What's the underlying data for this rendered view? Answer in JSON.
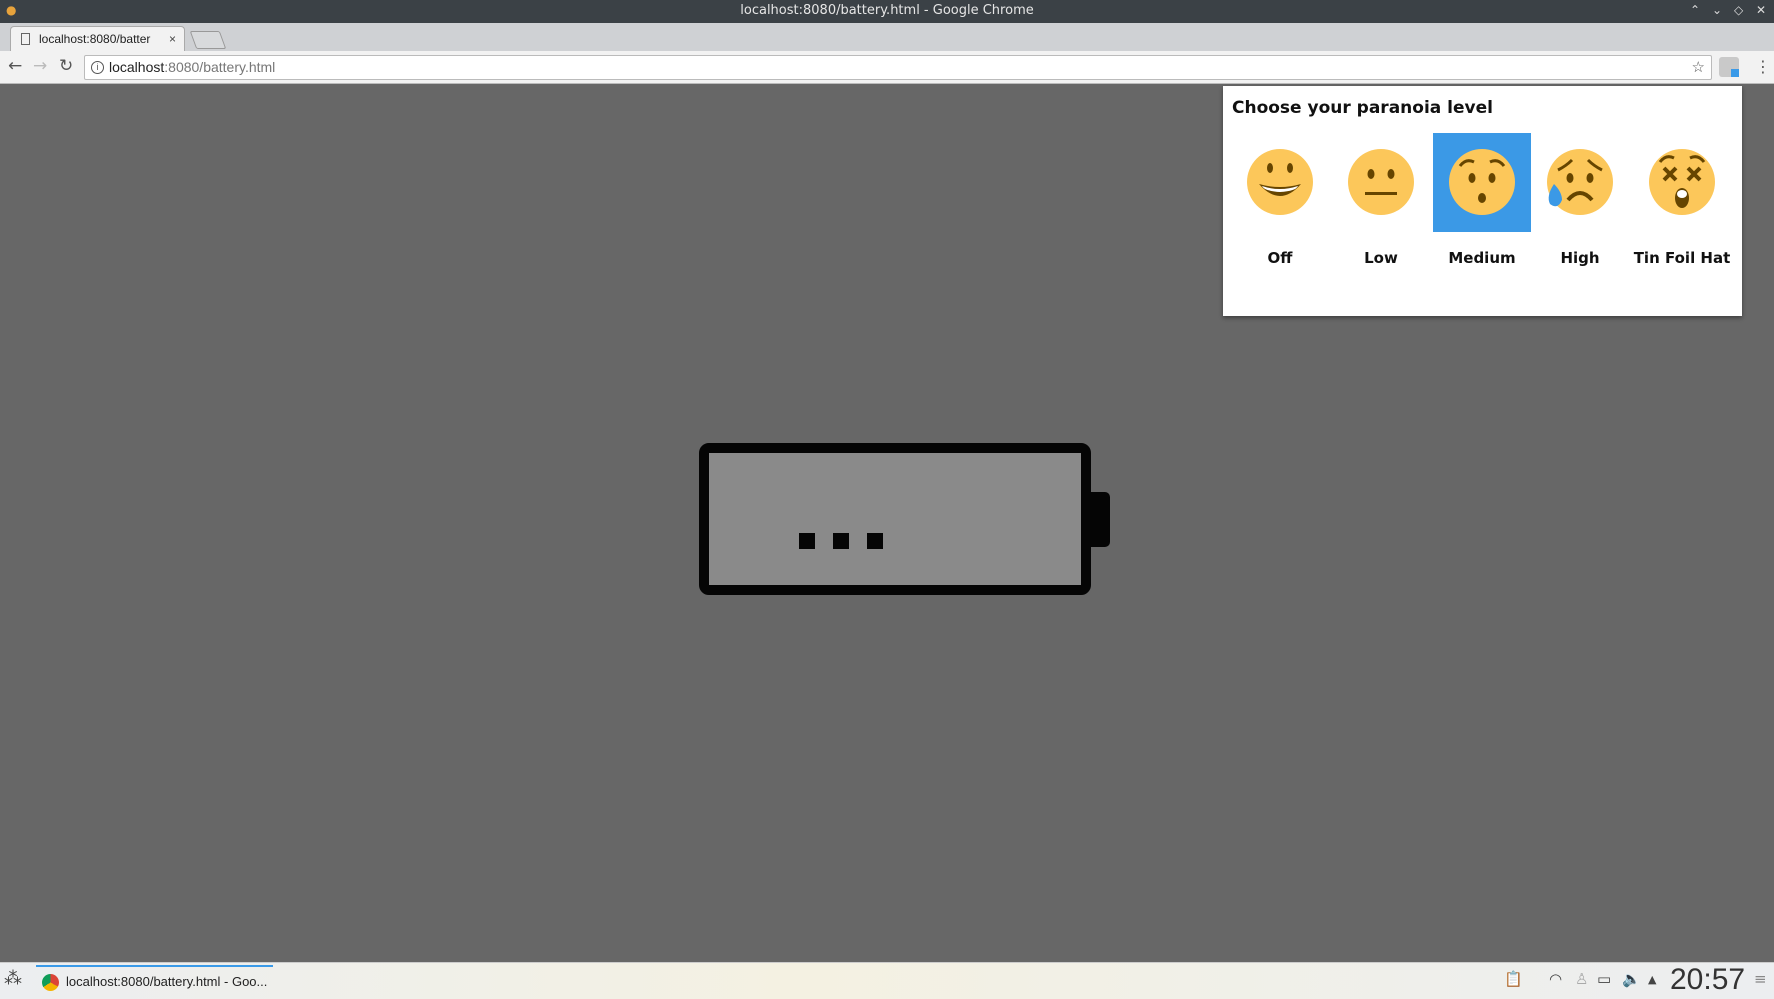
{
  "window": {
    "title": "localhost:8080/battery.html - Google Chrome"
  },
  "tab": {
    "label": "localhost:8080/batter",
    "close": "×"
  },
  "address": {
    "host": "localhost",
    "rest": ":8080/battery.html"
  },
  "popup": {
    "title": "Choose your paranoia level",
    "selected": "Medium",
    "levels": [
      {
        "label": "Off",
        "icon": "grinning-face-icon"
      },
      {
        "label": "Low",
        "icon": "neutral-face-icon"
      },
      {
        "label": "Medium",
        "icon": "hushed-face-icon"
      },
      {
        "label": "High",
        "icon": "sad-sweat-face-icon"
      },
      {
        "label": "Tin Foil Hat",
        "icon": "dizzy-face-icon"
      }
    ],
    "accent": "#3b99e6"
  },
  "page": {
    "battery_status": "..."
  },
  "taskbar": {
    "task_label": "localhost:8080/battery.html - Goo...",
    "clock": "20:57"
  }
}
